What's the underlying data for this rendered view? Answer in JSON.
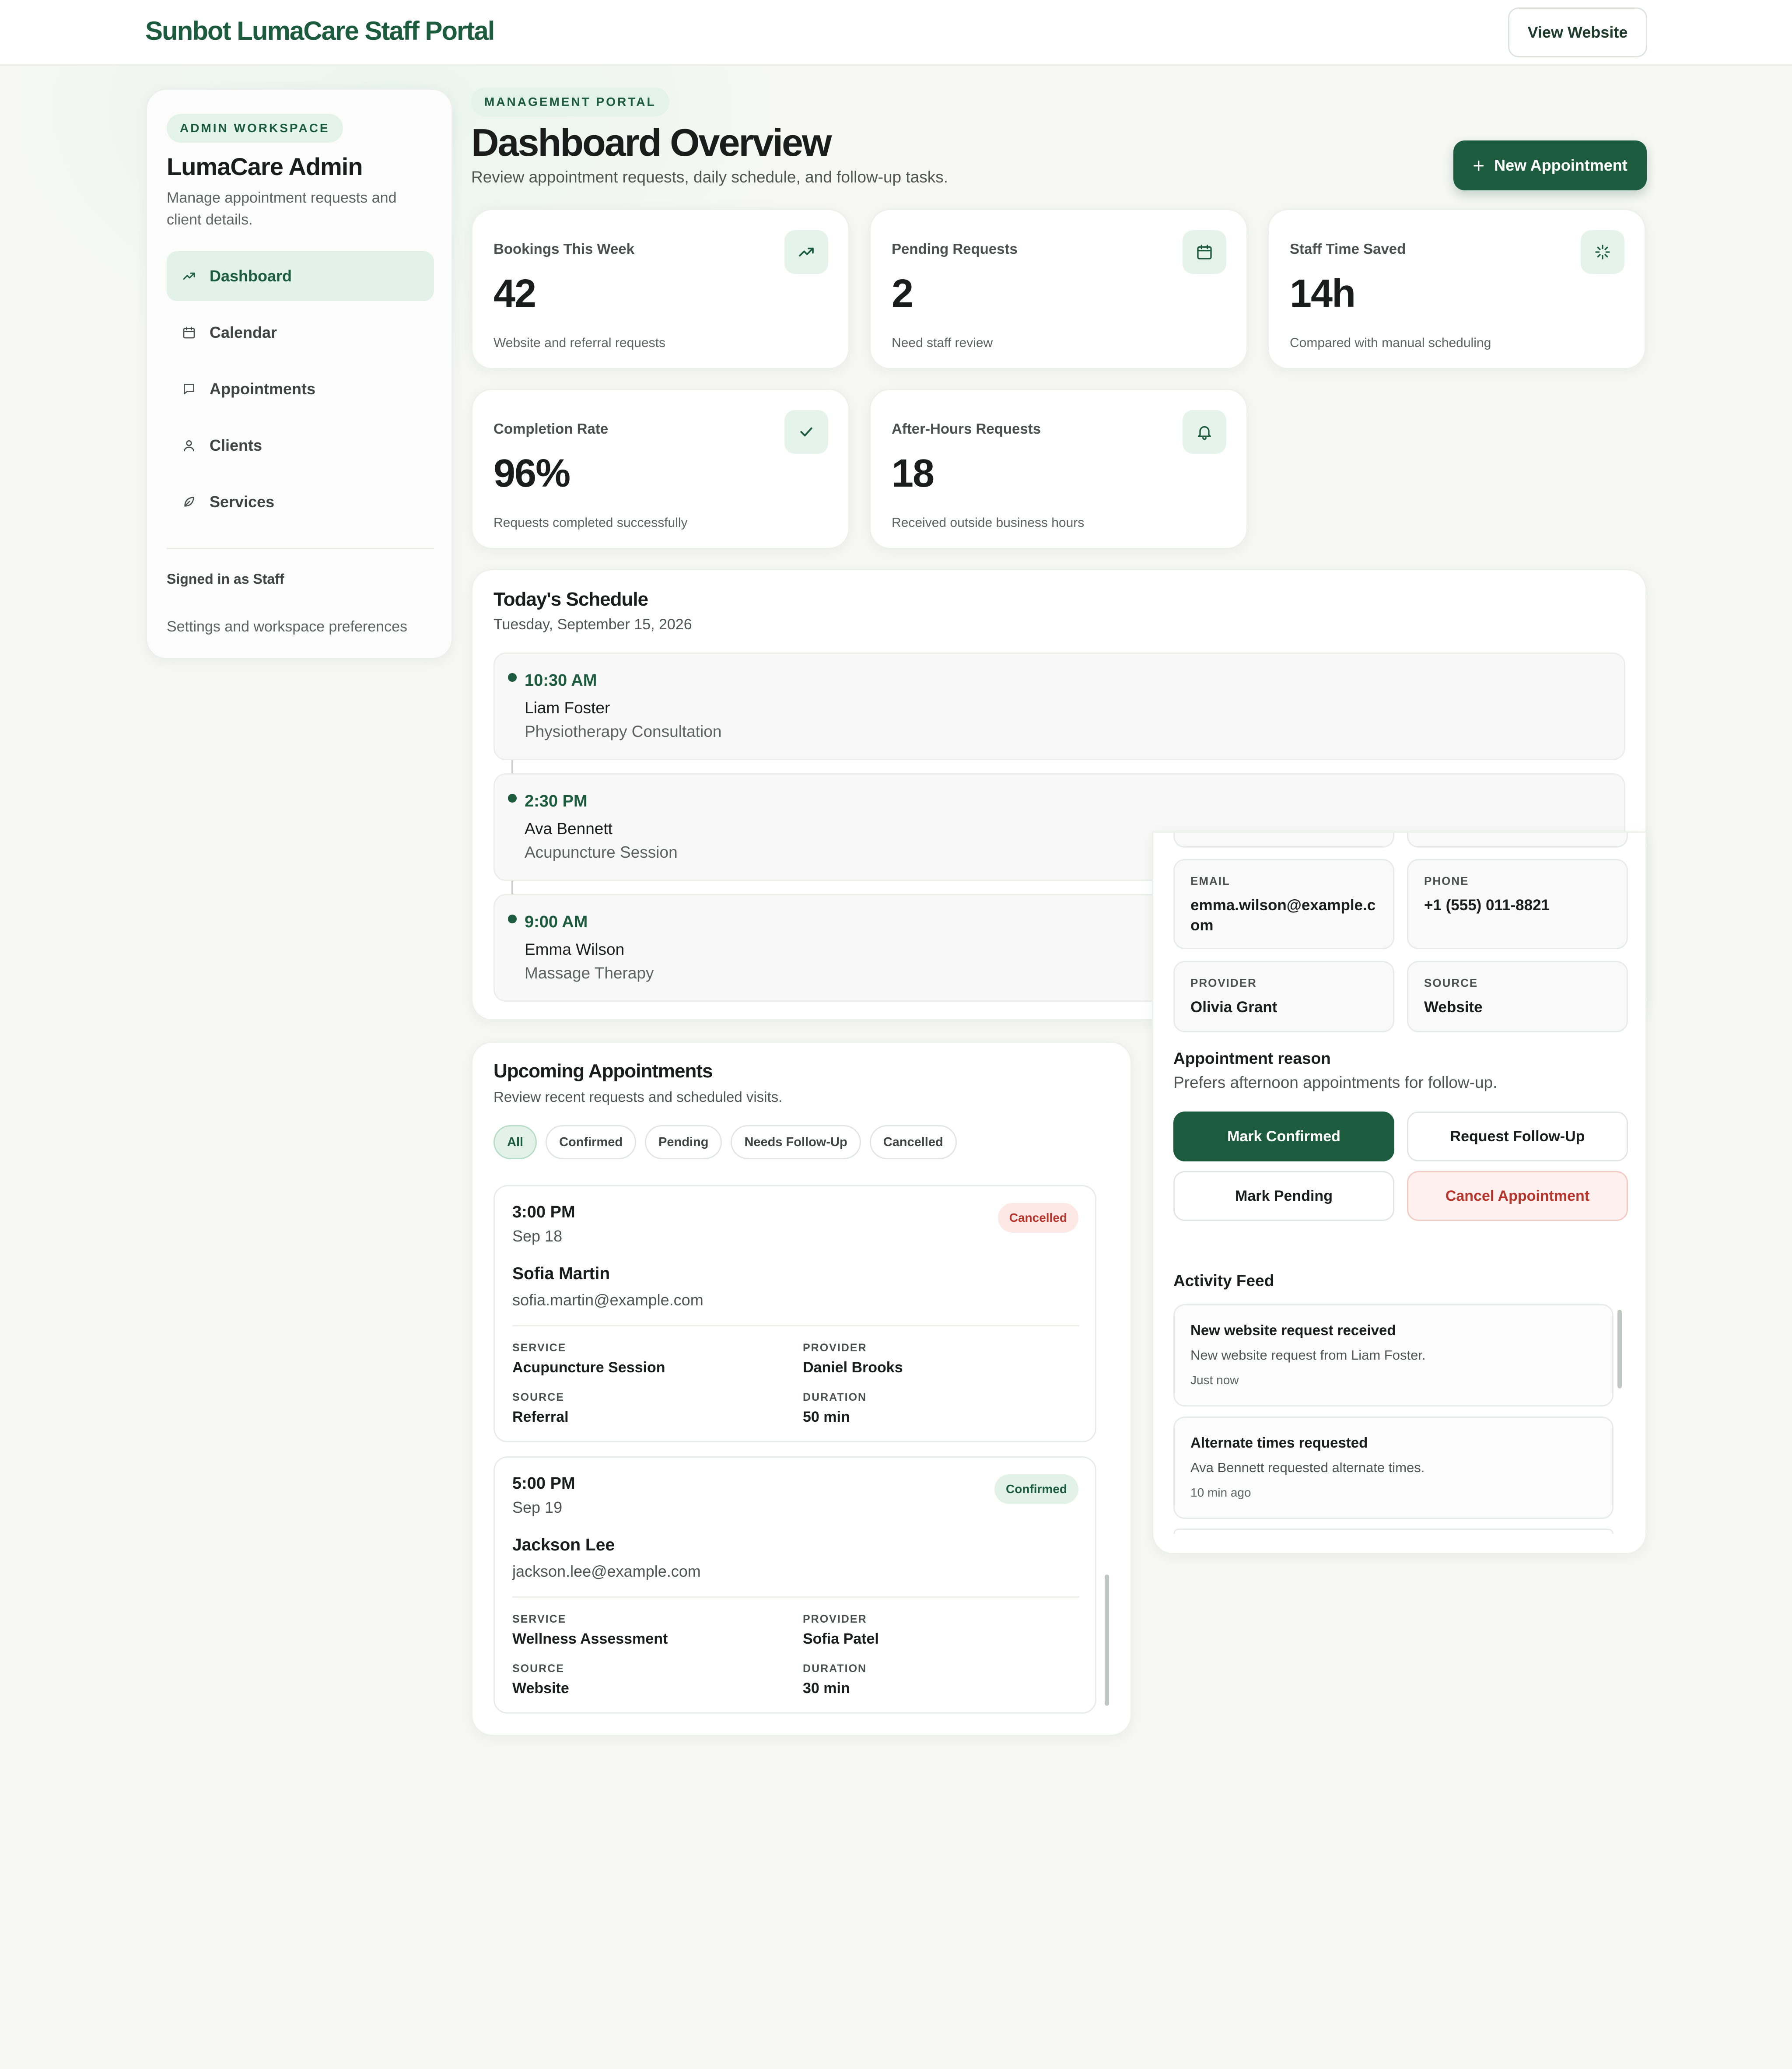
{
  "header": {
    "brand": "Sunbot LumaCare Staff Portal",
    "view_website": "View Website"
  },
  "sidebar": {
    "badge": "ADMIN WORKSPACE",
    "title": "LumaCare Admin",
    "subtitle": "Manage appointment requests and client details.",
    "items": [
      {
        "label": "Dashboard",
        "icon": "trend-up-icon",
        "active": true
      },
      {
        "label": "Calendar",
        "icon": "calendar-icon"
      },
      {
        "label": "Appointments",
        "icon": "chat-bubble-icon"
      },
      {
        "label": "Clients",
        "icon": "user-icon"
      },
      {
        "label": "Services",
        "icon": "leaf-icon"
      }
    ],
    "signed_in": "Signed in as Staff",
    "settings": "Settings and workspace preferences"
  },
  "main": {
    "badge": "MANAGEMENT PORTAL",
    "title": "Dashboard Overview",
    "subtitle": "Review appointment requests, daily schedule, and follow-up tasks.",
    "new_appointment": "New Appointment"
  },
  "stats": [
    {
      "label": "Bookings This Week",
      "value": "42",
      "note": "Website and referral requests",
      "icon": "trend-up-icon"
    },
    {
      "label": "Pending Requests",
      "value": "2",
      "note": "Need staff review",
      "icon": "calendar-icon"
    },
    {
      "label": "Staff Time Saved",
      "value": "14h",
      "note": "Compared with manual scheduling",
      "icon": "sparkle-icon"
    },
    {
      "label": "Completion Rate",
      "value": "96%",
      "note": "Requests completed successfully",
      "icon": "check-icon"
    },
    {
      "label": "After-Hours Requests",
      "value": "18",
      "note": "Received outside business hours",
      "icon": "bell-icon"
    }
  ],
  "schedule": {
    "title": "Today's Schedule",
    "date": "Tuesday, September 15, 2026",
    "items": [
      {
        "time": "10:30 AM",
        "name": "Liam Foster",
        "service": "Physiotherapy Consultation"
      },
      {
        "time": "2:30 PM",
        "name": "Ava Bennett",
        "service": "Acupuncture Session"
      },
      {
        "time": "9:00 AM",
        "name": "Emma Wilson",
        "service": "Massage Therapy"
      }
    ]
  },
  "upcoming": {
    "title": "Upcoming Appointments",
    "subtitle": "Review recent requests and scheduled visits.",
    "filters": [
      "All",
      "Confirmed",
      "Pending",
      "Needs Follow-Up",
      "Cancelled"
    ],
    "labels": {
      "service": "SERVICE",
      "provider": "PROVIDER",
      "source": "SOURCE",
      "duration": "DURATION"
    },
    "items": [
      {
        "time": "3:00 PM",
        "date": "Sep 18",
        "name": "Sofia Martin",
        "email": "sofia.martin@example.com",
        "status": "Cancelled",
        "service": "Acupuncture Session",
        "provider": "Daniel Brooks",
        "source": "Referral",
        "duration": "50 min"
      },
      {
        "time": "5:00 PM",
        "date": "Sep 19",
        "name": "Jackson Lee",
        "email": "jackson.lee@example.com",
        "status": "Confirmed",
        "service": "Wellness Assessment",
        "provider": "Sofia Patel",
        "source": "Website",
        "duration": "30 min"
      }
    ]
  },
  "detail": {
    "fields": [
      {
        "label": "EMAIL",
        "value": "emma.wilson@example.com"
      },
      {
        "label": "PHONE",
        "value": "+1 (555) 011-8821"
      },
      {
        "label": "PROVIDER",
        "value": "Olivia Grant"
      },
      {
        "label": "SOURCE",
        "value": "Website"
      }
    ],
    "reason_title": "Appointment reason",
    "reason": "Prefers afternoon appointments for follow-up.",
    "actions": {
      "confirm": "Mark Confirmed",
      "follow_up": "Request Follow-Up",
      "pending": "Mark Pending",
      "cancel": "Cancel Appointment"
    }
  },
  "activity": {
    "title": "Activity Feed",
    "items": [
      {
        "title": "New website request received",
        "desc": "New website request from Liam Foster.",
        "when": "Just now"
      },
      {
        "title": "Alternate times requested",
        "desc": "Ava Bennett requested alternate times.",
        "when": "10 min ago"
      }
    ]
  },
  "colors": {
    "brand": "#1d5b3e",
    "accent_bg": "#e2f2e9",
    "danger": "#b4352c"
  }
}
